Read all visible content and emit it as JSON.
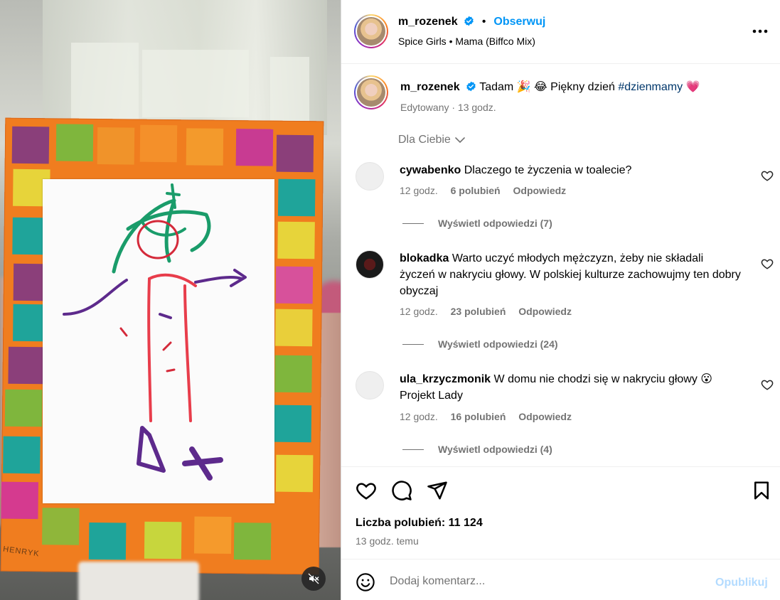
{
  "post": {
    "author": "m_rozenek",
    "follow_label": "Obserwuj",
    "separator": "•",
    "audio": "Spice Girls • Mama (Biffco Mix)",
    "caption": {
      "username": "m_rozenek",
      "text_before_hashtag": "Tadam 🎉 😂  Piękny dzień",
      "hashtag": "#dzienmamy",
      "text_after_hashtag": "💗",
      "meta": "Edytowany · 13 godz."
    },
    "image": {
      "signature": "HENRYK"
    }
  },
  "comments_section": {
    "sort_label": "Dla Ciebie",
    "comments": [
      {
        "username": "cywabenko",
        "text": "Dlaczego te życzenia w toalecie?",
        "time": "12 godz.",
        "likes": "6 polubień",
        "reply_label": "Odpowiedz",
        "view_replies": "Wyświetl odpowiedzi (7)"
      },
      {
        "username": "blokadka",
        "text": "Warto uczyć młodych mężczyzn, żeby nie składali życzeń w nakryciu głowy. W polskiej kulturze zachowujmy ten dobry obyczaj",
        "time": "12 godz.",
        "likes": "23 polubień",
        "reply_label": "Odpowiedz",
        "view_replies": "Wyświetl odpowiedzi (24)"
      },
      {
        "username": "ula_krzyczmonik",
        "text": "W domu nie chodzi się w nakryciu głowy 😮 Projekt Lady",
        "time": "12 godz.",
        "likes": "16 polubień",
        "reply_label": "Odpowiedz",
        "view_replies": "Wyświetl odpowiedzi (4)"
      }
    ]
  },
  "engagement": {
    "likes_label": "Liczba polubień: 11 124",
    "post_time": "13 godz. temu"
  },
  "comment_box": {
    "placeholder": "Dodaj komentarz...",
    "publish_label": "Opublikuj"
  },
  "colors": {
    "link_blue": "#0095f6",
    "hashtag": "#00376b",
    "muted_text": "#737373",
    "publish_disabled": "#b3dbff"
  }
}
